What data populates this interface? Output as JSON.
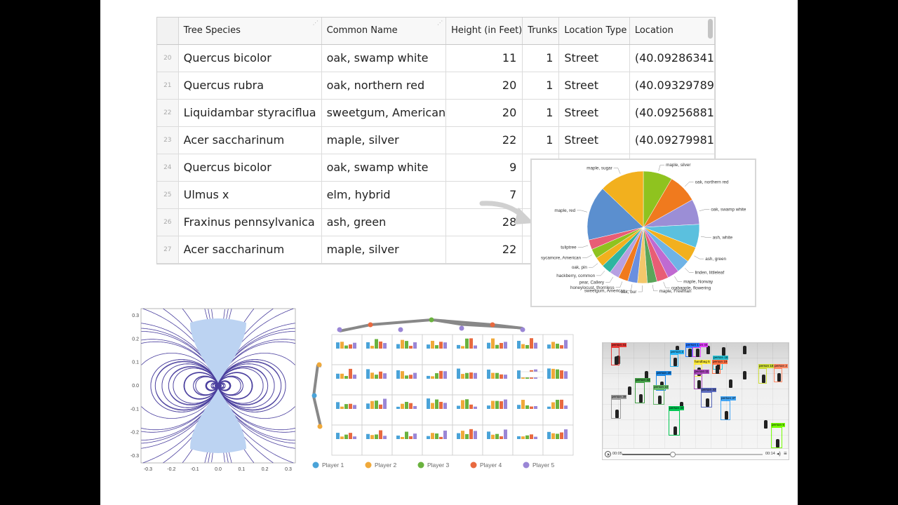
{
  "table": {
    "columns": [
      "Tree Species",
      "Common Name",
      "Height (in Feet)",
      "Trunks",
      "Location Type",
      "Location"
    ],
    "rows": [
      {
        "idx": "20",
        "species": "Quercus bicolor",
        "common": "oak, swamp white",
        "height": "11",
        "trunks": "1",
        "loctype": "Street",
        "location": "(40.09286341"
      },
      {
        "idx": "21",
        "species": "Quercus rubra",
        "common": "oak, northern red",
        "height": "20",
        "trunks": "1",
        "loctype": "Street",
        "location": "(40.09329789"
      },
      {
        "idx": "22",
        "species": "Liquidambar styraciflua",
        "common": "sweetgum, American",
        "height": "20",
        "trunks": "1",
        "loctype": "Street",
        "location": "(40.09256881"
      },
      {
        "idx": "23",
        "species": "Acer saccharinum",
        "common": "maple, silver",
        "height": "22",
        "trunks": "1",
        "loctype": "Street",
        "location": "(40.09279981"
      },
      {
        "idx": "24",
        "species": "Quercus bicolor",
        "common": "oak, swamp white",
        "height": "9",
        "trunks": "",
        "loctype": "",
        "location": ""
      },
      {
        "idx": "25",
        "species": "Ulmus x",
        "common": "elm, hybrid",
        "height": "7",
        "trunks": "",
        "loctype": "",
        "location": ""
      },
      {
        "idx": "26",
        "species": "Fraxinus pennsylvanica",
        "common": "ash, green",
        "height": "28",
        "trunks": "",
        "loctype": "",
        "location": ""
      },
      {
        "idx": "27",
        "species": "Acer saccharinum",
        "common": "maple, silver",
        "height": "22",
        "trunks": "",
        "loctype": "",
        "location": ""
      }
    ]
  },
  "pie": {
    "type": "pie",
    "slices": [
      {
        "label": "maple, silver",
        "value": 7.5,
        "color": "#8fc31f"
      },
      {
        "label": "oak, northern red",
        "value": 7.5,
        "color": "#f07a1e"
      },
      {
        "label": "oak, swamp white",
        "value": 6.5,
        "color": "#9b8ed6"
      },
      {
        "label": "ash, white",
        "value": 6,
        "color": "#5bc0de"
      },
      {
        "label": "ash, green",
        "value": 4,
        "color": "#f2b01e"
      },
      {
        "label": "linden, littleleaf",
        "value": 3.5,
        "color": "#6fb3e6"
      },
      {
        "label": "maple, Norway",
        "value": 3,
        "color": "#c06ad1"
      },
      {
        "label": "crabapple, flowering",
        "value": 3,
        "color": "#e85d75"
      },
      {
        "label": "maple, Freeman",
        "value": 2.5,
        "color": "#5aa55a"
      },
      {
        "label": "oak, bur",
        "value": 2.5,
        "color": "#f3c76b"
      },
      {
        "label": "sweetgum, American",
        "value": 2.5,
        "color": "#6a8fe0"
      },
      {
        "label": "honeylocust, thornless",
        "value": 2.5,
        "color": "#f07a1e"
      },
      {
        "label": "pear, Callery",
        "value": 2.5,
        "color": "#b7a0e2"
      },
      {
        "label": "hackberry, common",
        "value": 2.5,
        "color": "#2fb5a0"
      },
      {
        "label": "oak, pin",
        "value": 2.5,
        "color": "#f2b01e"
      },
      {
        "label": "sycamore, American",
        "value": 2.5,
        "color": "#8fc31f"
      },
      {
        "label": "tuliptree",
        "value": 2.5,
        "color": "#e85d75"
      },
      {
        "label": "maple, red",
        "value": 14,
        "color": "#5b8fcf"
      },
      {
        "label": "maple, sugar",
        "value": 11.5,
        "color": "#f2b01e"
      }
    ]
  },
  "vector_plot": {
    "xticks": [
      "-0.3",
      "-0.2",
      "-0.1",
      "0.0",
      "0.1",
      "0.2",
      "0.3"
    ],
    "yticks": [
      "0.3",
      "0.2",
      "0.1",
      "0.0",
      "-0.1",
      "-0.2",
      "-0.3"
    ]
  },
  "bar_grid": {
    "legend": [
      {
        "name": "Player 1",
        "color": "#4aa3d8"
      },
      {
        "name": "Player 2",
        "color": "#f0a93a"
      },
      {
        "name": "Player 3",
        "color": "#6ab23e"
      },
      {
        "name": "Player 4",
        "color": "#e8693f"
      },
      {
        "name": "Player 5",
        "color": "#9a86d6"
      }
    ]
  },
  "video": {
    "time_current": "00:05",
    "time_total": "00:14",
    "progress": 0.36,
    "detections": [
      {
        "label": "person 41",
        "color": "#e53935"
      },
      {
        "label": "person 44",
        "color": "#e040fb"
      },
      {
        "label": "person 3",
        "color": "#29b6f6"
      },
      {
        "label": "person 16",
        "color": "#26c6da"
      },
      {
        "label": "handbag 5",
        "color": "#ffeb3b"
      },
      {
        "label": "person 19",
        "color": "#ff7043"
      },
      {
        "label": "person 1",
        "color": "#2979ff"
      },
      {
        "label": "person 20",
        "color": "#1e88e5"
      },
      {
        "label": "person 22",
        "color": "#43a047"
      },
      {
        "label": "person 11",
        "color": "#ab47bc"
      },
      {
        "label": "person 10",
        "color": "#66bb6a"
      },
      {
        "label": "person 18",
        "color": "#cddc39"
      },
      {
        "label": "person 2",
        "color": "#ff8a65"
      },
      {
        "label": "person 39",
        "color": "#9e9e9e"
      },
      {
        "label": "person 33",
        "color": "#5c6bc0"
      },
      {
        "label": "person 37",
        "color": "#42a5f5"
      },
      {
        "label": "person 40",
        "color": "#00c853"
      },
      {
        "label": "person 5",
        "color": "#76ff03"
      }
    ]
  }
}
